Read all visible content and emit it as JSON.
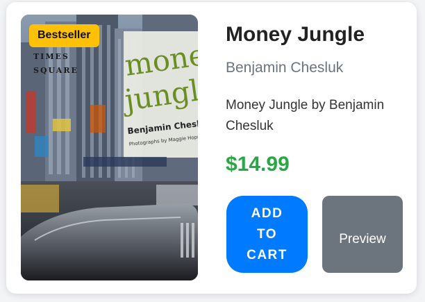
{
  "product": {
    "badge": "Bestseller",
    "title": "Money Jungle",
    "author": "Benjamin Chesluk",
    "description": "Money Jungle by Benjamin Chesluk",
    "price": "$14.99",
    "add_to_cart_label": "ADD TO CART",
    "preview_label": "Preview"
  },
  "cover": {
    "title_line1": "money",
    "title_line2": "jungle",
    "author": "Benjamin Chesluk",
    "credit": "Photographs by Maggie Hopp",
    "street_sign_line1": "TIMES",
    "street_sign_line2": "SQUARE"
  },
  "colors": {
    "badge": "#ffc107",
    "price": "#28a745",
    "add_to_cart": "#007bff",
    "preview": "#6c757d",
    "cover_title": "#6b8e23"
  }
}
